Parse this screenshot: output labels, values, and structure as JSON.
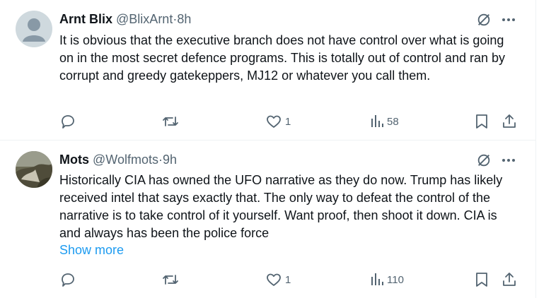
{
  "tweets": [
    {
      "author_name": "Arnt Blix",
      "handle": "@BlixArnt",
      "separator": "·",
      "time": "8h",
      "text": "It is obvious that the executive branch does not have control over what is going on in the most secret defence programs. This is totally out of control and ran by corrupt and greedy gatekeppers, MJ12 or whatever you call them.",
      "show_more": "",
      "likes": "1",
      "views": "58",
      "avatar_icon": "default-avatar-icon"
    },
    {
      "author_name": "Mots",
      "handle": "@Wolfmots",
      "separator": "·",
      "time": "9h",
      "text": "Historically CIA has owned the UFO narrative as they do now. Trump has likely received intel that says exactly that. The only way to defeat the control of the narrative is to take control of it yourself. Want proof, then shoot it down. CIA is and always has been the police force",
      "show_more": "Show more",
      "likes": "1",
      "views": "110",
      "avatar_icon": "photo-avatar-icon"
    }
  ],
  "colors": {
    "text": "#0f1419",
    "secondary": "#536471",
    "link": "#1d9bf0",
    "divider": "#eff3f4"
  }
}
